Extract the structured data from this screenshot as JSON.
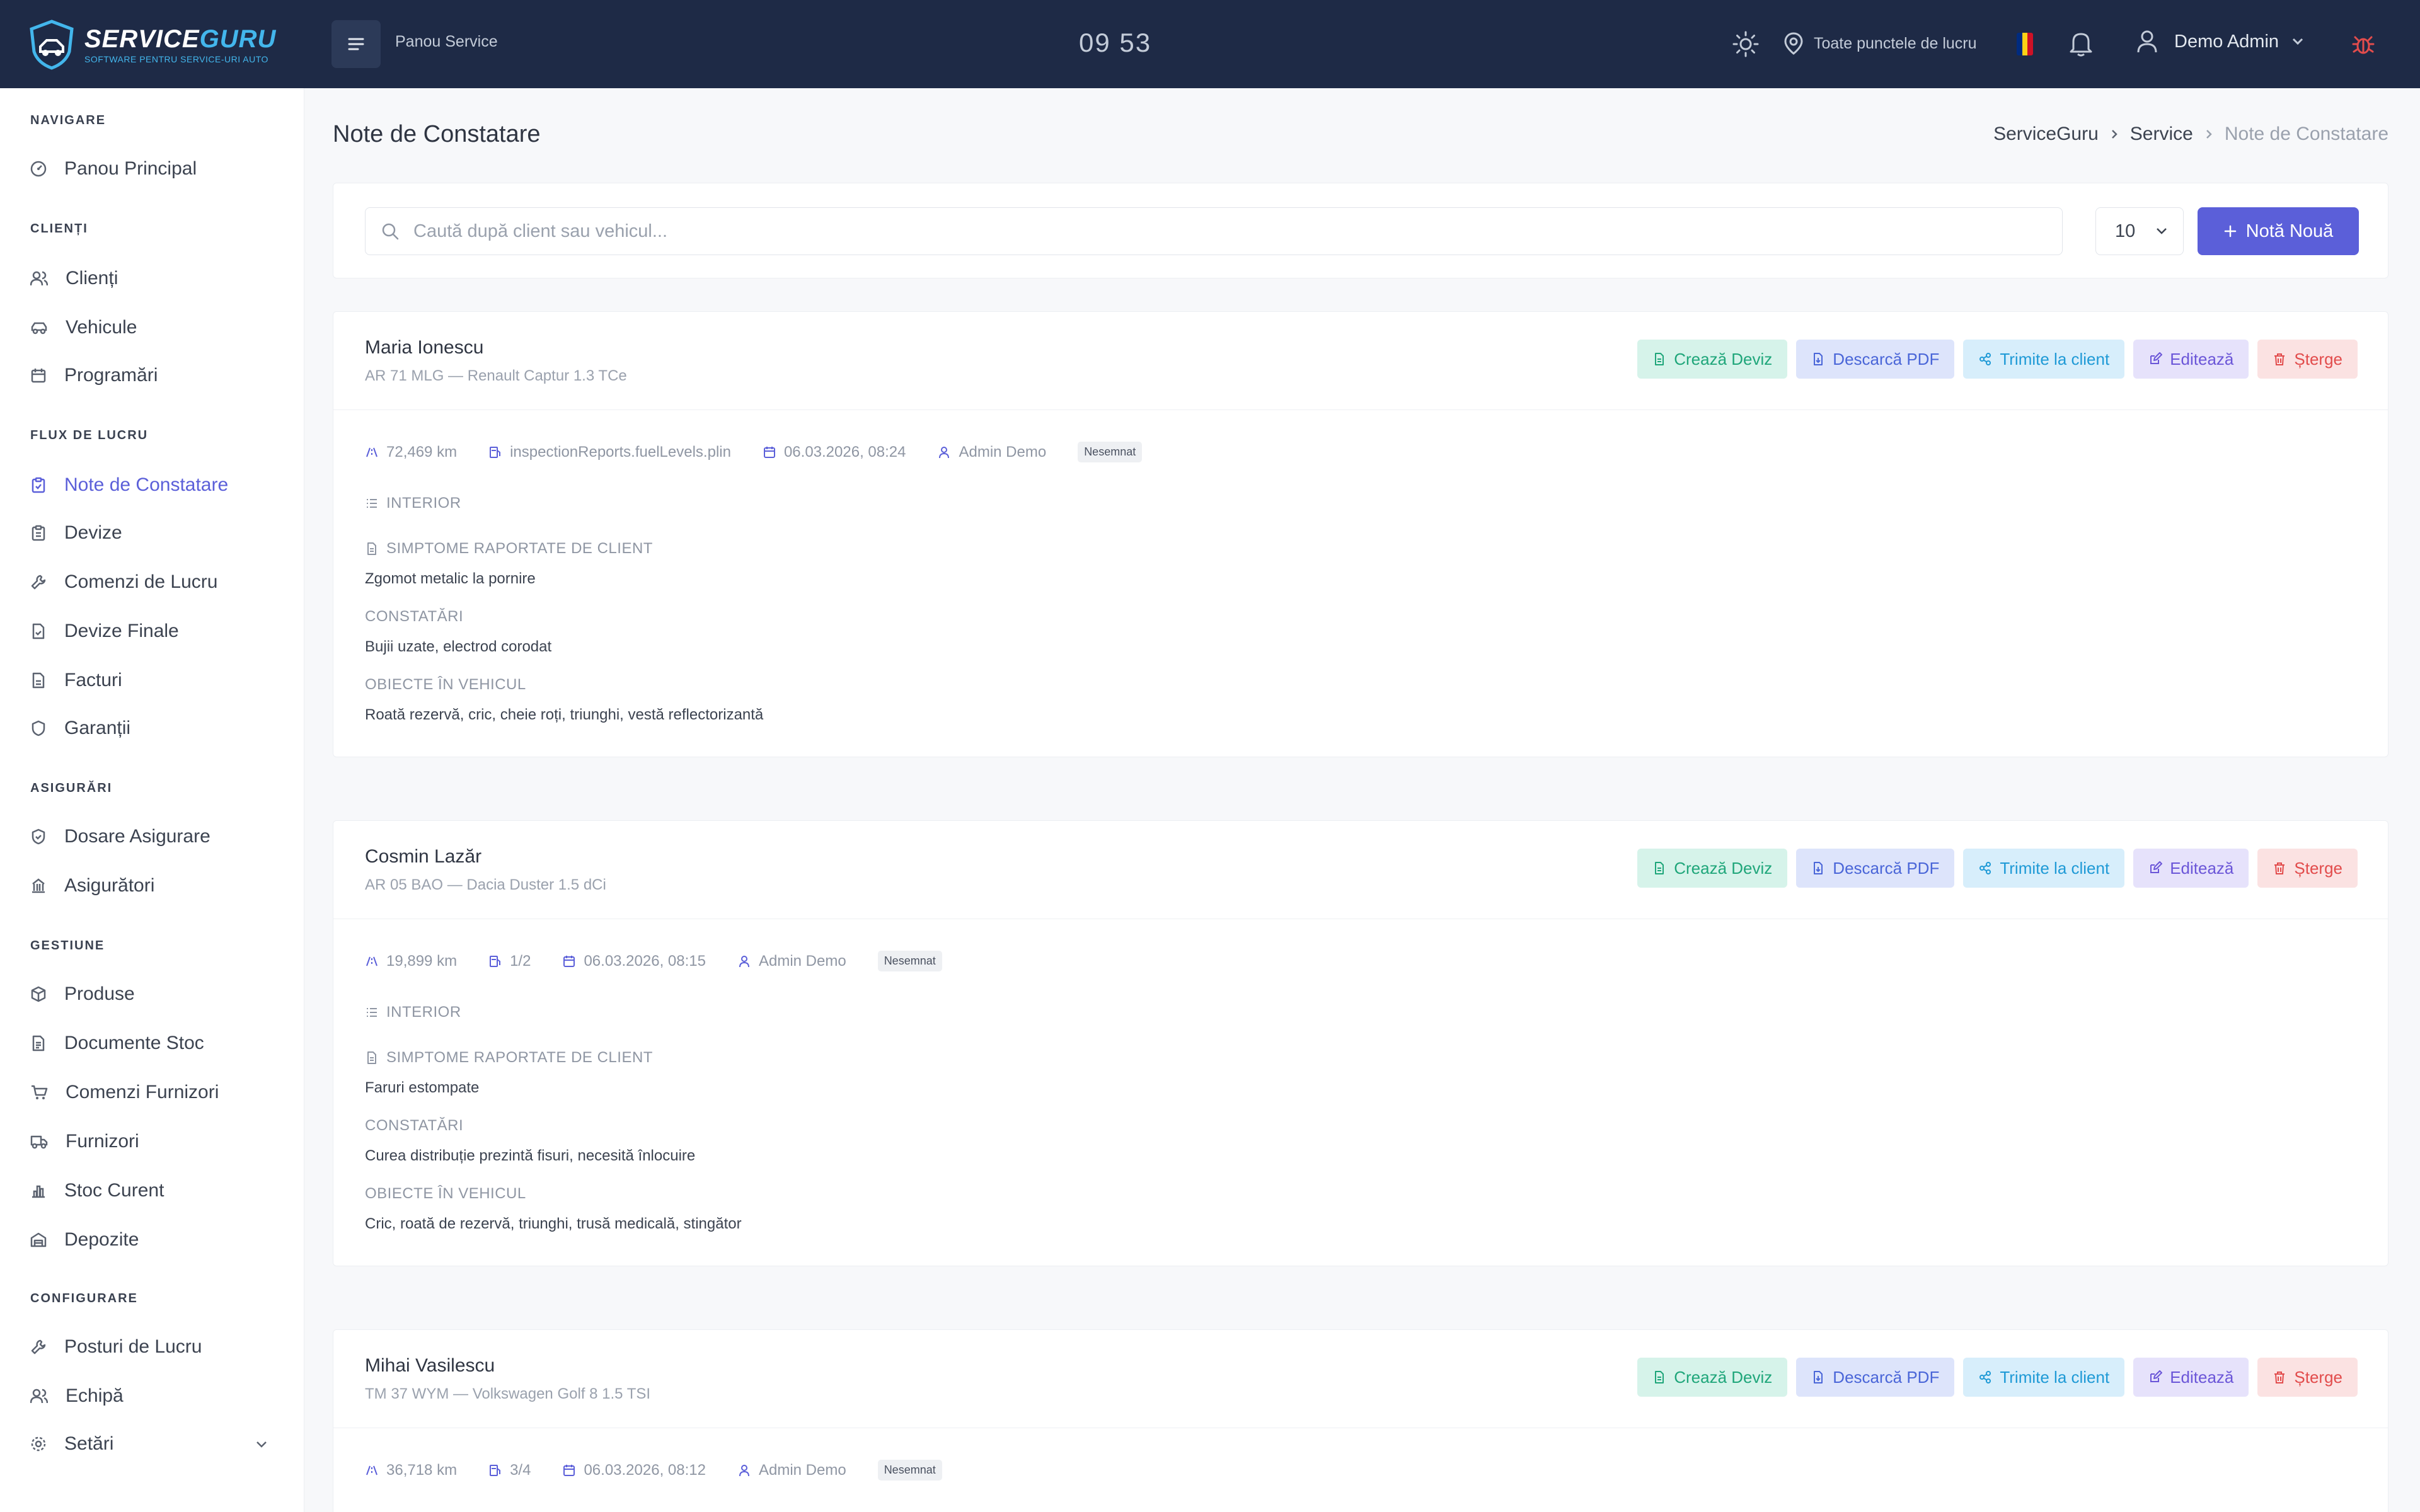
{
  "topbar": {
    "logo_title_a": "SERVICE",
    "logo_title_b": "GURU",
    "logo_subtitle": "SOFTWARE PENTRU SERVICE-URI AUTO",
    "panel_label": "Panou Service",
    "clock": "09 53",
    "location": "Toate punctele de lucru",
    "user_name": "Demo Admin"
  },
  "sidebar": {
    "sections": [
      {
        "title": "NAVIGARE",
        "items": [
          {
            "label": "Panou Principal",
            "icon": "dashboard-icon"
          }
        ]
      },
      {
        "title": "CLIENȚI",
        "items": [
          {
            "label": "Clienți",
            "icon": "users-icon"
          },
          {
            "label": "Vehicule",
            "icon": "car-icon"
          },
          {
            "label": "Programări",
            "icon": "calendar-icon"
          }
        ]
      },
      {
        "title": "FLUX DE LUCRU",
        "items": [
          {
            "label": "Note de Constatare",
            "icon": "clipboard-icon"
          },
          {
            "label": "Devize",
            "icon": "clipboard-list-icon"
          },
          {
            "label": "Comenzi de Lucru",
            "icon": "wrench-icon"
          },
          {
            "label": "Devize Finale",
            "icon": "file-check-icon"
          },
          {
            "label": "Facturi",
            "icon": "file-icon"
          },
          {
            "label": "Garanții",
            "icon": "shield-icon"
          }
        ]
      },
      {
        "title": "ASIGURĂRI",
        "items": [
          {
            "label": "Dosare Asigurare",
            "icon": "shield-check-icon"
          },
          {
            "label": "Asigurători",
            "icon": "building-icon"
          }
        ]
      },
      {
        "title": "GESTIUNE",
        "items": [
          {
            "label": "Produse",
            "icon": "box-icon"
          },
          {
            "label": "Documente Stoc",
            "icon": "document-icon"
          },
          {
            "label": "Comenzi Furnizori",
            "icon": "cart-icon"
          },
          {
            "label": "Furnizori",
            "icon": "truck-icon"
          },
          {
            "label": "Stoc Curent",
            "icon": "bar-chart-icon"
          },
          {
            "label": "Depozite",
            "icon": "warehouse-icon"
          }
        ]
      },
      {
        "title": "CONFIGURARE",
        "items": [
          {
            "label": "Posturi de Lucru",
            "icon": "wrench-icon"
          },
          {
            "label": "Echipă",
            "icon": "team-icon"
          },
          {
            "label": "Setări",
            "icon": "gear-icon"
          }
        ]
      }
    ]
  },
  "page": {
    "title": "Note de Constatare",
    "breadcrumb": [
      "ServiceGuru",
      "Service",
      "Note de Constatare"
    ],
    "search_placeholder": "Caută după client sau vehicul...",
    "per_page": "10",
    "new_button": "Notă Nouă"
  },
  "actions": {
    "create_quote": "Crează Deviz",
    "download_pdf": "Descarcă PDF",
    "send_client": "Trimite la client",
    "edit": "Editează",
    "delete": "Șterge"
  },
  "labels": {
    "interior": "INTERIOR",
    "symptoms": "SIMPTOME RAPORTATE DE CLIENT",
    "findings": "CONSTATĂRI",
    "objects": "OBIECTE ÎN VEHICUL"
  },
  "reports": [
    {
      "client": "Maria Ionescu",
      "plate": "AR 71 MLG",
      "vehicle": "Renault Captur 1.3 TCe",
      "km": "72,469 km",
      "fuel": "inspectionReports.fuelLevels.plin",
      "date": "06.03.2026, 08:24",
      "author": "Admin Demo",
      "status": "Nesemnat",
      "symptoms": "Zgomot metalic la pornire",
      "findings": "Bujii uzate, electrod corodat",
      "objects": "Roată rezervă, cric, cheie roți, triunghi, vestă reflectorizantă"
    },
    {
      "client": "Cosmin Lazăr",
      "plate": "AR 05 BAO",
      "vehicle": "Dacia Duster 1.5 dCi",
      "km": "19,899 km",
      "fuel": "1/2",
      "date": "06.03.2026, 08:15",
      "author": "Admin Demo",
      "status": "Nesemnat",
      "symptoms": "Faruri estompate",
      "findings": "Curea distribuție prezintă fisuri, necesită înlocuire",
      "objects": "Cric, roată de rezervă, triunghi, trusă medicală, stingător"
    },
    {
      "client": "Mihai Vasilescu",
      "plate": "TM 37 WYM",
      "vehicle": "Volkswagen Golf 8 1.5 TSI",
      "km": "36,718 km",
      "fuel": "3/4",
      "date": "06.03.2026, 08:12",
      "author": "Admin Demo",
      "status": "Nesemnat"
    }
  ],
  "colors": {
    "topbar": "#1e2a46",
    "accent": "#5b5fd9",
    "logo_accent": "#43b6ec"
  }
}
